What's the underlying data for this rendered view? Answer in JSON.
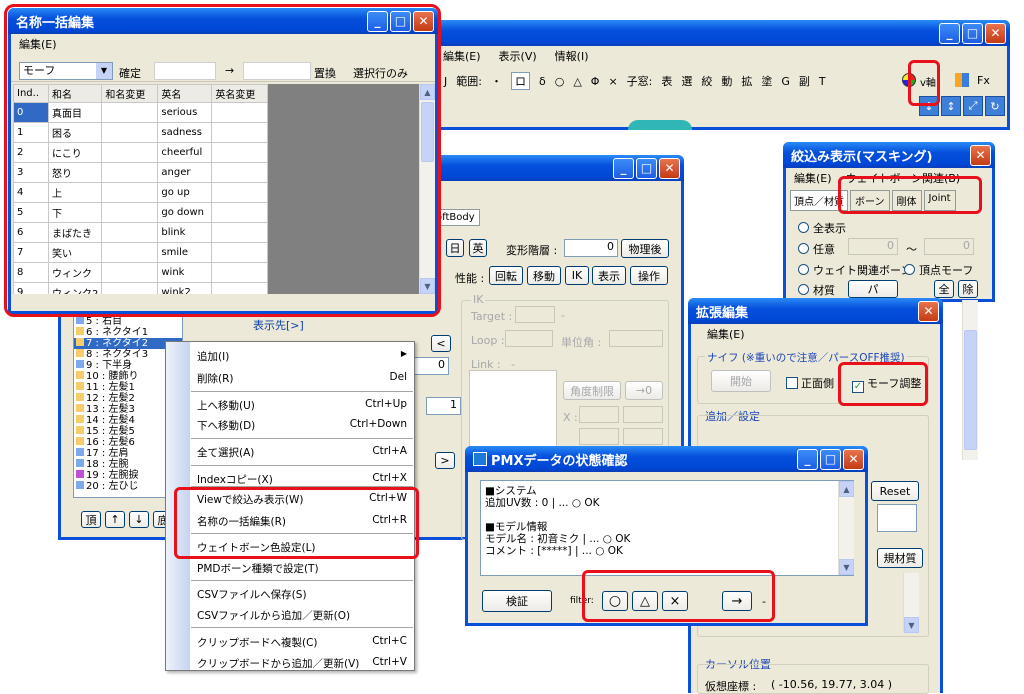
{
  "main_window": {
    "menus": [
      "編集(E)",
      "表示(V)",
      "情報(I)"
    ],
    "toolbar": {
      "j": "J",
      "range_label": "範囲:",
      "dot": "・",
      "box": "ロ",
      "delta": "δ",
      "circle": "○",
      "triangle": "△",
      "phi": "Φ",
      "times": "×",
      "subwin_label": "子窓:",
      "items": [
        "表",
        "選",
        "絞",
        "動",
        "拡",
        "塗",
        "G",
        "副",
        "T"
      ],
      "v_axis": "v軸",
      "fx": "Fx"
    }
  },
  "bone_panel": {
    "tab_softbody": "oftBody",
    "btn_day": "日",
    "btn_ei": "英",
    "transform_label": "変形階層 :",
    "transform_value": "0",
    "btn_physics_after": "物理後",
    "perf_label": "性能 :",
    "btn_rotate": "回転",
    "btn_move": "移動",
    "btn_ik": "IK",
    "btn_show": "表示",
    "btn_operate": "操作",
    "ik": {
      "title": "IK",
      "target": "Target :",
      "loop": "Loop :",
      "unit_angle": "単位角 :",
      "link": "Link :",
      "dash": "-",
      "angle_limit": "角度制限",
      "arrow_zero": "→0",
      "x": "X :"
    },
    "display_target": "表示先[>]",
    "bone_list": [
      "5 : 右目",
      "6 : ネクタイ1",
      "7 : ネクタイ2",
      "8 : ネクタイ3",
      "9 : 下半身",
      "10 : 腰飾り",
      "11 : 左髪1",
      "12 : 左髪2",
      "13 : 左髪3",
      "14 : 左髪4",
      "15 : 左髪5",
      "16 : 左髪6",
      "17 : 左肩",
      "18 : 左腕",
      "19 : 左腕捩",
      "20 : 左ひじ"
    ],
    "bottom_buttons": [
      "頂",
      "↑",
      "↓",
      "底"
    ],
    "btn_less": "<",
    "btn_more": ">",
    "val_1": "1",
    "val_0": "0"
  },
  "context_menu": {
    "items": [
      {
        "label": "追加(I)",
        "shortcut": ""
      },
      {
        "label": "削除(R)",
        "shortcut": "Del"
      },
      {
        "label": "上へ移動(U)",
        "shortcut": "Ctrl+Up"
      },
      {
        "label": "下へ移動(D)",
        "shortcut": "Ctrl+Down"
      },
      {
        "label": "全て選択(A)",
        "shortcut": "Ctrl+A"
      },
      {
        "label": "Indexコピー(X)",
        "shortcut": "Ctrl+X"
      },
      {
        "label": "Viewで絞込み表示(W)",
        "shortcut": "Ctrl+W"
      },
      {
        "label": "名称の一括編集(R)",
        "shortcut": "Ctrl+R"
      },
      {
        "label": "ウェイトボーン色設定(L)",
        "shortcut": ""
      },
      {
        "label": "PMDボーン種類で設定(T)",
        "shortcut": ""
      },
      {
        "label": "CSVファイルへ保存(S)",
        "shortcut": ""
      },
      {
        "label": "CSVファイルから追加／更新(O)",
        "shortcut": ""
      },
      {
        "label": "クリップボードへ複製(C)",
        "shortcut": "Ctrl+C"
      },
      {
        "label": "クリップボードから追加／更新(V)",
        "shortcut": "Ctrl+V"
      }
    ],
    "submenu_arrow": "▶"
  },
  "rename_window": {
    "title": "名称一括編集",
    "menu": "編集(E)",
    "type_select": "モーフ",
    "confirm": "確定",
    "arrow": "→",
    "replace": "置換",
    "selected_only": "選択行のみ",
    "columns": [
      "Ind..",
      "和名",
      "和名変更",
      "英名",
      "英名変更"
    ],
    "rows": [
      [
        "0",
        "真面目",
        "",
        "serious",
        ""
      ],
      [
        "1",
        "困る",
        "",
        "sadness",
        ""
      ],
      [
        "2",
        "にこり",
        "",
        "cheerful",
        ""
      ],
      [
        "3",
        "怒り",
        "",
        "anger",
        ""
      ],
      [
        "4",
        "上",
        "",
        "go up",
        ""
      ],
      [
        "5",
        "下",
        "",
        "go down",
        ""
      ],
      [
        "6",
        "まばたき",
        "",
        "blink",
        ""
      ],
      [
        "7",
        "笑い",
        "",
        "smile",
        ""
      ],
      [
        "8",
        "ウィンク",
        "",
        "wink",
        ""
      ],
      [
        "9",
        "ウィンク2",
        "",
        "wink2",
        ""
      ]
    ]
  },
  "mask_window": {
    "title": "絞込み表示(マスキング)",
    "menu": "編集(E)",
    "weight_bone": "ウェイトボーン関連(B)",
    "tabs": [
      "頂点／材質",
      "ボーン",
      "剛体",
      "Joint"
    ],
    "all_show": "全表示",
    "any": "任意",
    "weight_related": "ウェイト関連ボーン",
    "vertex_morph": "頂点モーフ",
    "range_val1": "0",
    "range_val2": "0",
    "tilde": "〜",
    "material": "材質",
    "btn_all": "全",
    "btn_remove": "除",
    "partial": "パ"
  },
  "ext_window": {
    "title": "拡張編集",
    "menu": "編集(E)",
    "knife": "ナイフ (※重いので注意／パースOFF推奨)",
    "start": "開始",
    "front_side": "正面側",
    "morph_adjust": "モーフ調整",
    "add_settings": "追加／設定",
    "reset": "Reset",
    "new_material": "規材質",
    "cursor_pos": "カーソル位置",
    "virtual_coords": "仮想座標 :",
    "coords_value": "( -10.56, 19.77, 3.04 )"
  },
  "pmx_window": {
    "title": "PMXデータの状態確認",
    "text_lines": [
      "■システム",
      "追加UV数 : 0 | ... ○ OK",
      "",
      "■モデル情報",
      "モデル名 : 初音ミク | ... ○ OK",
      "コメント : [*****] | ... ○ OK"
    ],
    "verify": "検証",
    "filter": "filter:",
    "filter_buttons": [
      "○",
      "△",
      "×"
    ],
    "arrow": "→",
    "dash": "-"
  }
}
